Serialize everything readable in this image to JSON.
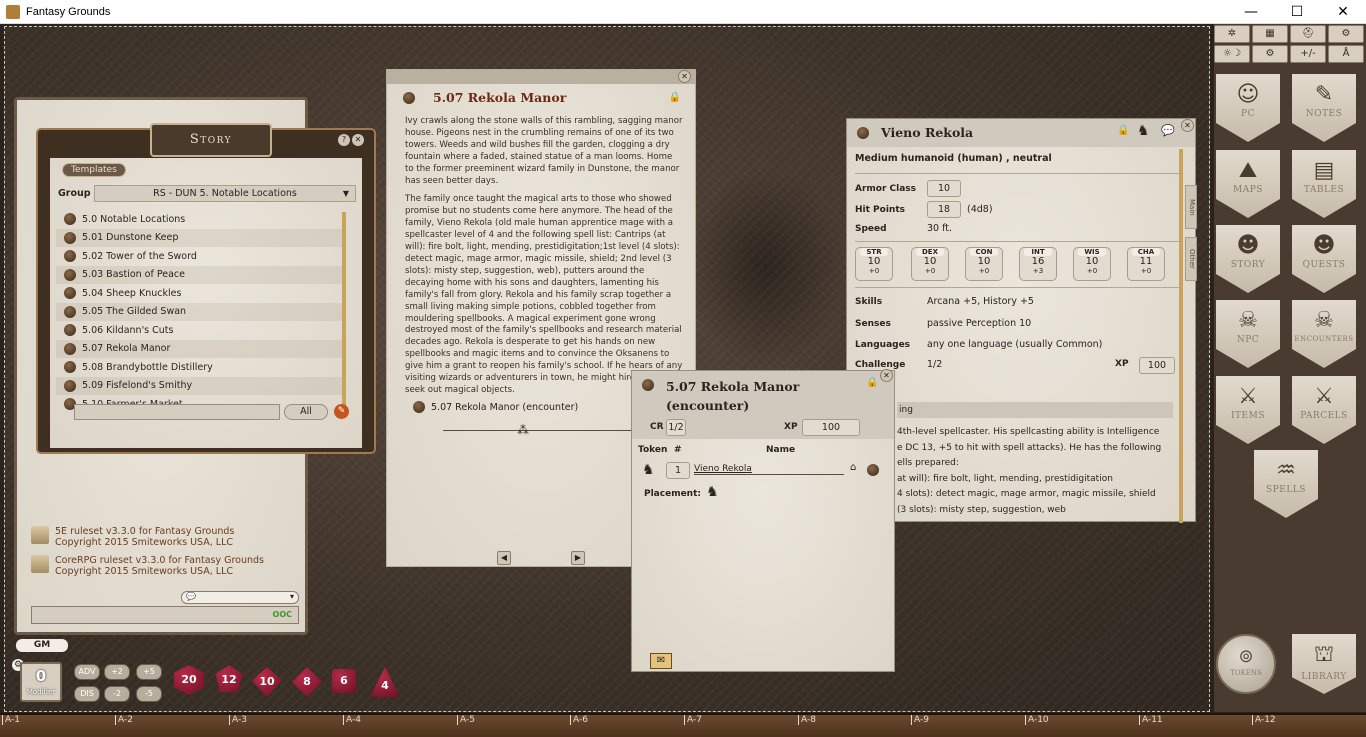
{
  "window": {
    "title": "Fantasy Grounds",
    "minimize": "—",
    "maximize": "☐",
    "close": "✕"
  },
  "toolbar": {
    "buttons": [
      "✲",
      "▦",
      "⛑",
      "⚙",
      "☼☽",
      "⚙",
      "+/-",
      "Å"
    ]
  },
  "sidebar": {
    "items": [
      {
        "label": "PC",
        "icon": "☺"
      },
      {
        "label": "NOTES",
        "icon": "✎"
      },
      {
        "label": "MAPS",
        "icon": "⛰"
      },
      {
        "label": "TABLES",
        "icon": "▤"
      },
      {
        "label": "STORY",
        "icon": "☻"
      },
      {
        "label": "QUESTS",
        "icon": "☻"
      },
      {
        "label": "NPC",
        "icon": "☠"
      },
      {
        "label": "ENCOUNTERS",
        "icon": "☠"
      },
      {
        "label": "ITEMS",
        "icon": "⚔"
      },
      {
        "label": "PARCELS",
        "icon": "⚔"
      },
      {
        "label": "SPELLS",
        "icon": "♒"
      }
    ],
    "tokens_label": "TOKENS",
    "library_label": "LIBRARY"
  },
  "ruler": [
    "A-1",
    "A-2",
    "A-3",
    "A-4",
    "A-5",
    "A-6",
    "A-7",
    "A-8",
    "A-9",
    "A-10",
    "A-11",
    "A-12"
  ],
  "chat": {
    "entries": [
      {
        "line1": "5E ruleset v3.3.0 for Fantasy Grounds",
        "line2": "Copyright 2015 Smiteworks USA, LLC"
      },
      {
        "line1": "CoreRPG ruleset v3.3.0 for Fantasy Grounds",
        "line2": "Copyright 2015 Smiteworks USA, LLC"
      }
    ],
    "ooc_label": "OOC"
  },
  "story": {
    "title": "Story",
    "templates_label": "Templates",
    "group_label": "Group",
    "group_value": "RS - DUN 5. Notable Locations",
    "items": [
      "5.0 Notable Locations",
      "5.01 Dunstone Keep",
      "5.02 Tower of the Sword",
      "5.03 Bastion of Peace",
      "5.04 Sheep Knuckles",
      "5.05 The Gilded Swan",
      "5.06 Kildann's Cuts",
      "5.07 Rekola Manor",
      "5.08 Brandybottle Distillery",
      "5.09 Fisfelond's Smithy",
      "5.10 Farmer's Market"
    ],
    "all_label": "All"
  },
  "entry": {
    "title": "5.07 Rekola Manor",
    "p1": "Ivy crawls along the stone walls of this rambling, sagging manor house. Pigeons nest in the crumbling remains of one of its two towers. Weeds and wild bushes fill the garden, clogging a dry fountain where a faded, stained statue of a man looms. Home to the former preeminent wizard family in Dunstone, the manor has seen better days.",
    "p2": "The family once taught the magical arts to those who showed promise but no students come here anymore. The head of the family, Vieno Rekola (old male human apprentice mage with a spellcaster level of 4 and the following spell list: Cantrips (at will): fire bolt, light, mending, prestidigitation;1st level (4 slots): detect magic, mage armor, magic missile, shield; 2nd level (3 slots): misty step, suggestion, web), putters around the decaying home with his sons and daughters, lamenting his family's fall from glory. Rekola and his family scrap together a small living making simple potions, cobbled together from mouldering spellbooks. A magical experiment gone wrong destroyed most of the family's spellbooks and research material decades ago. Rekola is desperate to get his hands on new spellbooks and magic items and to convince the Oksanens to give him a grant to reopen his family's school. If he hears of any visiting wizards or adventurers in town, he might hire them to seek out magical objects.",
    "link": "5.07 Rekola Manor (encounter)"
  },
  "encounter": {
    "title": "5.07 Rekola Manor (encounter)",
    "cr_label": "CR",
    "cr_value": "1/2",
    "xp_label": "XP",
    "xp_value": "100",
    "token_label": "Token",
    "num_label": "#",
    "name_label": "Name",
    "npc_count": "1",
    "npc_name": "Vieno Rekola",
    "placement_label": "Placement:"
  },
  "npc": {
    "name": "Vieno Rekola",
    "type": "Medium humanoid (human) , neutral",
    "ac_label": "Armor Class",
    "ac": "10",
    "hp_label": "Hit Points",
    "hp": "18",
    "hd": "(4d8)",
    "speed_label": "Speed",
    "speed": "30 ft.",
    "stats": [
      {
        "ab": "STR",
        "score": "10",
        "mod": "+0"
      },
      {
        "ab": "DEX",
        "score": "10",
        "mod": "+0"
      },
      {
        "ab": "CON",
        "score": "10",
        "mod": "+0"
      },
      {
        "ab": "INT",
        "score": "16",
        "mod": "+3"
      },
      {
        "ab": "WIS",
        "score": "10",
        "mod": "+0"
      },
      {
        "ab": "CHA",
        "score": "11",
        "mod": "+0"
      }
    ],
    "skills_label": "Skills",
    "skills": "Arcana +5, History +5",
    "senses_label": "Senses",
    "senses": "passive Perception 10",
    "languages_label": "Languages",
    "languages": "any one language (usually Common)",
    "challenge_label": "Challenge",
    "challenge": "1/2",
    "xp_label": "XP",
    "xp": "100",
    "trait_partial": "ing",
    "spell_l1": "4th-level spellcaster. His spellcasting ability is Intelligence",
    "spell_l2": "e DC 13, +5 to hit with spell attacks). He has the following",
    "spell_l3": "ells prepared:",
    "spell_l4": "at will): fire bolt, light, mending, prestidigitation",
    "spell_l5": "4 slots): detect magic, mage armor, magic missile, shield",
    "spell_l6": "(3 slots): misty step, suggestion, web",
    "tab_main": "Main",
    "tab_other": "Other"
  },
  "dice_bar": {
    "gm_label": "GM",
    "modifier_value": "0",
    "modifier_label": "Modifier",
    "adv": "ADV",
    "dis": "DIS",
    "p2": "+2",
    "m2": "-2",
    "p5": "+5",
    "m5": "-5",
    "dice": [
      "20",
      "12",
      "10",
      "8",
      "6",
      "4"
    ]
  }
}
